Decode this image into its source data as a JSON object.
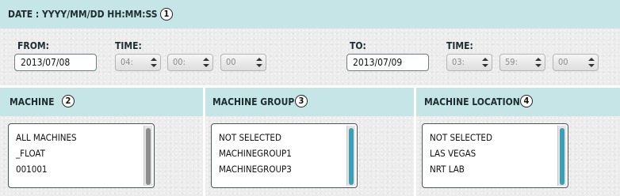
{
  "date_section": {
    "title": "DATE : YYYY/MM/DD HH:MM:SS",
    "badge": "1",
    "from": {
      "label": "FROM:",
      "date": "2013/07/08",
      "time_label": "TIME:",
      "hour": "04:",
      "minute": "00:",
      "second": "00"
    },
    "to": {
      "label": "TO:",
      "date": "2013/07/09",
      "time_label": "TIME:",
      "hour": "03:",
      "minute": "59:",
      "second": "00"
    }
  },
  "machine": {
    "title": "MACHINE",
    "badge": "2",
    "items": [
      "ALL MACHINES",
      "_FLOAT",
      "001001"
    ]
  },
  "machine_group": {
    "title": "MACHINE GROUP",
    "badge": "3",
    "items": [
      "NOT SELECTED",
      "MACHINEGROUP1",
      "MACHINEGROUP3"
    ]
  },
  "machine_location": {
    "title": "MACHINE LOCATION",
    "badge": "4",
    "items": [
      "NOT SELECTED",
      "LAS VEGAS",
      "NRT LAB"
    ]
  },
  "colors": {
    "header_band": "#c6e5e6",
    "scroll_thumb_active": "#3d9fb5",
    "scroll_thumb_inactive": "#8c8c8c"
  }
}
